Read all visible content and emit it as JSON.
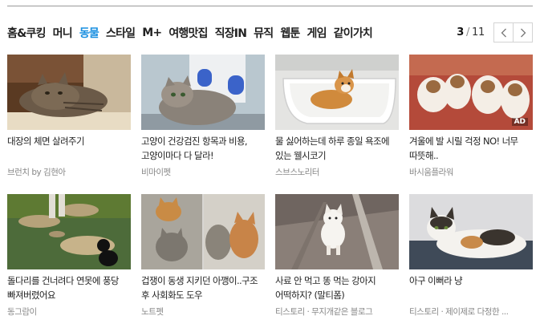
{
  "tabs": [
    {
      "label": "홈&쿠킹",
      "active": false
    },
    {
      "label": "머니",
      "active": false
    },
    {
      "label": "동물",
      "active": true
    },
    {
      "label": "스타일",
      "active": false
    },
    {
      "label": "M+",
      "active": false
    },
    {
      "label": "여행맛집",
      "active": false
    },
    {
      "label": "직장IN",
      "active": false
    },
    {
      "label": "뮤직",
      "active": false
    },
    {
      "label": "웹툰",
      "active": false
    },
    {
      "label": "게임",
      "active": false
    },
    {
      "label": "같이가치",
      "active": false
    }
  ],
  "pager": {
    "current": "3",
    "total": "11",
    "separator": "/"
  },
  "ad_label": "AD",
  "cards": [
    {
      "title": "대장의 체면 살려주기",
      "source": "브런치 by 김현아",
      "image": "tabby-cat-lying-icon"
    },
    {
      "title": "고양이 건강검진 항목과 비용, 고양이마다 다 달라!",
      "source": "비마이펫",
      "image": "vet-examining-cat-icon"
    },
    {
      "title": "물 싫어하는데 하루 종일 욕조에 있는 웰시코기",
      "source": "스브스노리터",
      "image": "corgi-in-bathtub-icon"
    },
    {
      "title": "겨울에 발 시릴 걱정 NO! 너무 따뜻해..",
      "source": "바시움플라워",
      "image": "bear-slippers-icon",
      "ad": true
    },
    {
      "title": "돌다리를 건너려다 연못에 풍당 빠져버렸어요",
      "source": "동그람이",
      "image": "dog-stepping-stones-icon"
    },
    {
      "title": "겁쟁이 동생 지키던 아깽이..구조 후 사회화도 도우",
      "source": "노트펫",
      "image": "kittens-collage-icon"
    },
    {
      "title": "사료 안 먹고 똥 먹는 강아지 어떡하지? (말티폼)",
      "source": "티스토리 · 무지개같은 블로그",
      "image": "white-puppy-walking-icon"
    },
    {
      "title": "아구 이뻐라 냥",
      "source": "티스토리 · 제이제로 다정한 ...",
      "image": "calico-cat-lying-icon"
    }
  ]
}
